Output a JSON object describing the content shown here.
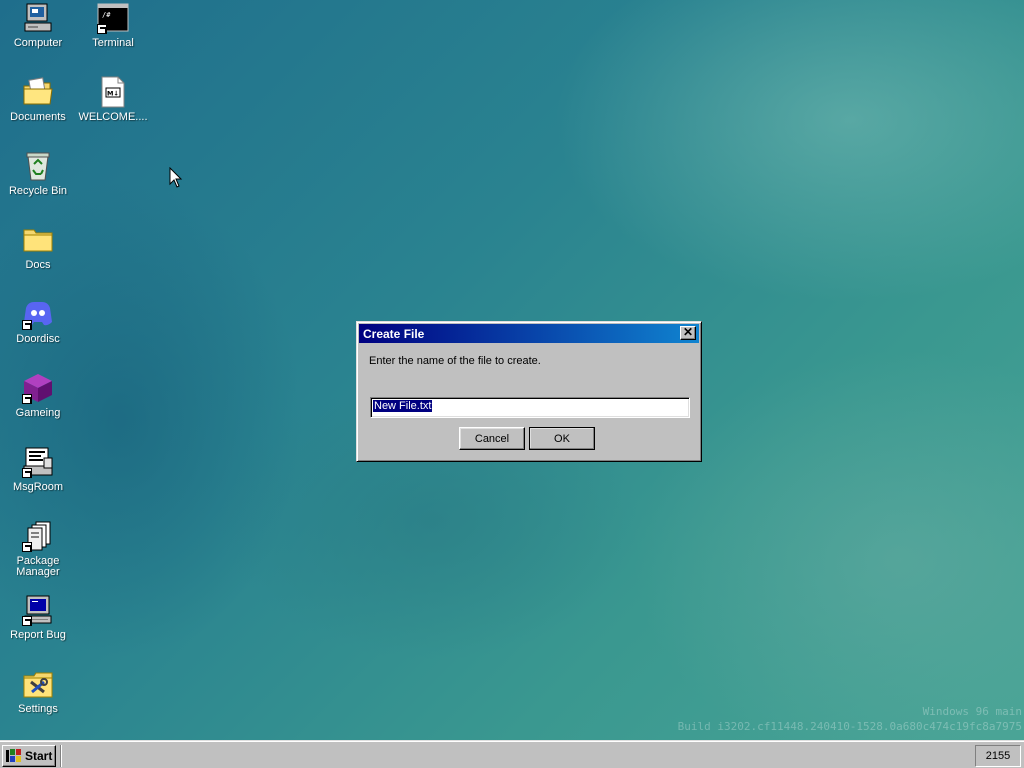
{
  "desktop": {
    "icons": [
      {
        "label": "Computer",
        "icon": "computer-icon"
      },
      {
        "label": "Terminal",
        "icon": "terminal-icon"
      },
      {
        "label": "Documents",
        "icon": "documents-folder-icon"
      },
      {
        "label": "WELCOME....",
        "icon": "markdown-file-icon"
      },
      {
        "label": "Recycle Bin",
        "icon": "recycle-bin-icon"
      },
      {
        "label": "Docs",
        "icon": "folder-icon"
      },
      {
        "label": "Doordisc",
        "icon": "doordisc-icon"
      },
      {
        "label": "Gameing",
        "icon": "gameing-cube-icon"
      },
      {
        "label": "MsgRoom",
        "icon": "msgroom-icon"
      },
      {
        "label": "Package Manager",
        "icon": "package-manager-icon"
      },
      {
        "label": "Report Bug",
        "icon": "report-bug-icon"
      },
      {
        "label": "Settings",
        "icon": "settings-icon"
      }
    ],
    "terminal_glyph": "/#",
    "markdown_glyph": "M↓"
  },
  "dialog": {
    "title": "Create File",
    "close_glyph": "✕",
    "prompt": "Enter the name of the file to create.",
    "input_value": "New File.txt",
    "cancel_label": "Cancel",
    "ok_label": "OK"
  },
  "watermark": {
    "line1": "Windows 96 main",
    "line2": "Build i3202.cf11448.240410-1528.0a680c474c19fc8a7975"
  },
  "taskbar": {
    "start_label": "Start",
    "clock": "2155"
  },
  "colors": {
    "title_start": "#000080",
    "title_end": "#1084d0",
    "desktop": "#2a8390"
  }
}
